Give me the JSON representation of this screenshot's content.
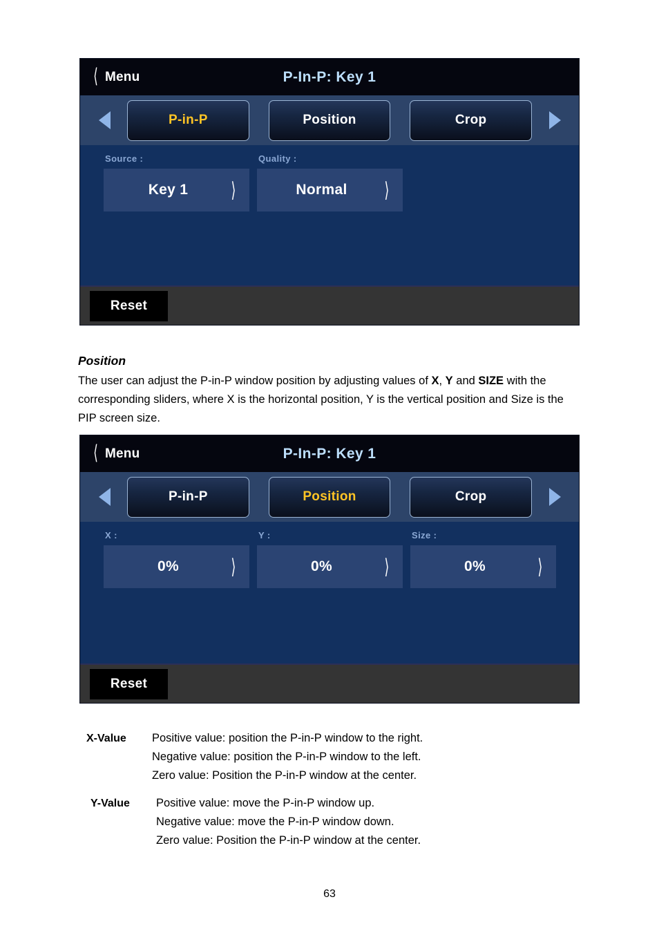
{
  "panels": [
    {
      "titlebar": {
        "back_icon": "chevron-left-icon",
        "back_label": "Menu",
        "title": "P-In-P: Key 1"
      },
      "nav": {
        "prev_icon": "triangle-left-icon",
        "next_icon": "triangle-right-icon"
      },
      "tabs": [
        {
          "label": "P-in-P",
          "active": true
        },
        {
          "label": "Position",
          "active": false
        },
        {
          "label": "Crop",
          "active": false
        }
      ],
      "fields": [
        {
          "label": "Source :",
          "value": "Key 1",
          "chevron": "chevron-right-icon"
        },
        {
          "label": "Quality :",
          "value": "Normal",
          "chevron": "chevron-right-icon"
        }
      ],
      "footer": {
        "reset_label": "Reset"
      }
    },
    {
      "titlebar": {
        "back_icon": "chevron-left-icon",
        "back_label": "Menu",
        "title": "P-In-P: Key 1"
      },
      "nav": {
        "prev_icon": "triangle-left-icon",
        "next_icon": "triangle-right-icon"
      },
      "tabs": [
        {
          "label": "P-in-P",
          "active": false
        },
        {
          "label": "Position",
          "active": true
        },
        {
          "label": "Crop",
          "active": false
        }
      ],
      "fields": [
        {
          "label": "X :",
          "value": "0%",
          "chevron": "chevron-right-icon"
        },
        {
          "label": "Y :",
          "value": "0%",
          "chevron": "chevron-right-icon"
        },
        {
          "label": "Size :",
          "value": "0%",
          "chevron": "chevron-right-icon"
        }
      ],
      "footer": {
        "reset_label": "Reset"
      }
    }
  ],
  "section": {
    "heading": "Position",
    "paragraph_parts": [
      {
        "text": "The user can adjust the P-in-P window position by adjusting values of ",
        "bold": false
      },
      {
        "text": "X",
        "bold": true
      },
      {
        "text": ", ",
        "bold": false
      },
      {
        "text": "Y",
        "bold": true
      },
      {
        "text": " and ",
        "bold": false
      },
      {
        "text": "SIZE",
        "bold": true
      },
      {
        "text": " with the corresponding sliders, where X is the horizontal position, Y is the vertical position and Size is the PIP screen size.",
        "bold": false
      }
    ]
  },
  "definitions": [
    {
      "term": "X-Value",
      "lines": [
        "Positive value: position the P-in-P window to the right.",
        "Negative value: position the P-in-P window to the left.",
        "Zero value: Position the P-in-P window at the center."
      ]
    },
    {
      "term": "Y-Value",
      "lines": [
        "Positive value: move the P-in-P window up.",
        "Negative value: move the P-in-P window down.",
        "Zero value: Position the P-in-P window at the center."
      ]
    }
  ],
  "page_number": "63",
  "colors": {
    "titlebar_bg": "#05060f",
    "tabrow_bg": "#2d4469",
    "content_bg": "#12305f",
    "field_bg": "#2b4473",
    "footer_bg": "#343434",
    "accent_yellow": "#ffc425",
    "title_blue": "#bcdefb",
    "label_blue": "#8ba8d4",
    "arrow_blue": "#8fb5e8"
  }
}
